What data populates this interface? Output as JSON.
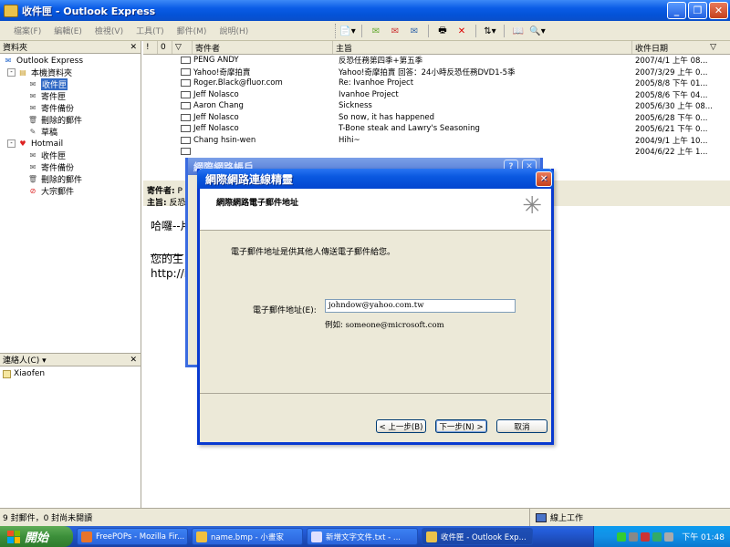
{
  "window": {
    "title": "收件匣 - Outlook Express"
  },
  "menu": [
    "檔案(F)",
    "編輯(E)",
    "檢視(V)",
    "工具(T)",
    "郵件(M)",
    "說明(H)"
  ],
  "folders": {
    "header": "資料夾",
    "items": [
      {
        "label": "Outlook Express",
        "level": 0,
        "icon": "outlook-icon"
      },
      {
        "label": "本機資料夾",
        "level": 1,
        "icon": "local-folders-icon",
        "expand": "-"
      },
      {
        "label": "收件匣",
        "level": 2,
        "icon": "inbox-icon",
        "selected": true
      },
      {
        "label": "寄件匣",
        "level": 2,
        "icon": "outbox-icon"
      },
      {
        "label": "寄件備份",
        "level": 2,
        "icon": "sent-items-icon"
      },
      {
        "label": "刪除的郵件",
        "level": 2,
        "icon": "deleted-items-icon"
      },
      {
        "label": "草稿",
        "level": 2,
        "icon": "drafts-icon"
      },
      {
        "label": "Hotmail",
        "level": 1,
        "icon": "hotmail-icon",
        "expand": "-"
      },
      {
        "label": "收件匣",
        "level": 2,
        "icon": "inbox-icon"
      },
      {
        "label": "寄件備份",
        "level": 2,
        "icon": "sent-items-icon"
      },
      {
        "label": "刪除的郵件",
        "level": 2,
        "icon": "deleted-items-icon"
      },
      {
        "label": "大宗郵件",
        "level": 2,
        "icon": "junk-mail-icon"
      }
    ]
  },
  "contacts": {
    "header": "連絡人(C) ▾",
    "items": [
      "Xiaofen"
    ]
  },
  "message_list": {
    "columns": [
      "!",
      "0",
      "▽",
      "寄件者",
      "主旨",
      "收件日期"
    ],
    "rows": [
      {
        "from": "PENG ANDY",
        "subject": "反恐任務第四季+第五季",
        "date": "2007/4/1 上午 08..."
      },
      {
        "from": "Yahoo!奇摩拍賣",
        "subject": "Yahoo!奇摩拍賣 回答：24小時反恐任務DVD1-5季",
        "date": "2007/3/29 上午 0..."
      },
      {
        "from": "Roger.Black@fluor.com",
        "subject": "Re: Ivanhoe Project",
        "date": "2005/8/8 下午 01..."
      },
      {
        "from": "Jeff Nolasco",
        "subject": "Ivanhoe Project",
        "date": "2005/8/6 下午 04..."
      },
      {
        "from": "Aaron Chang",
        "subject": "Sickness",
        "date": "2005/6/30 上午 08..."
      },
      {
        "from": "Jeff Nolasco",
        "subject": "So now, it has happened",
        "date": "2005/6/28 下午 0..."
      },
      {
        "from": "Jeff Nolasco",
        "subject": "T-Bone steak and Lawry's Seasoning",
        "date": "2005/6/21 下午 0..."
      },
      {
        "from": "Chang hsin-wen",
        "subject": "Hihi~",
        "date": "2004/9/1 上午 10..."
      },
      {
        "from": "",
        "subject": "",
        "date": "2004/6/22 上午 1..."
      }
    ]
  },
  "preview": {
    "from_label": "寄件者:",
    "from_value": "P",
    "subject_label": "主旨:",
    "subject_value": "反恐",
    "body_lines": [
      "哈囉--片",
      "______",
      "您的生",
      "http://m"
    ]
  },
  "back_dialog": {
    "title": "網際網路帳戶"
  },
  "wizard": {
    "title": "網際網路連線精靈",
    "heading": "網際網路電子郵件地址",
    "intro": "電子郵件地址是供其他人傳送電子郵件給您。",
    "email_label": "電子郵件地址(E):",
    "email_value": "johndow@yahoo.com.tw",
    "example_label": "例如:",
    "example_value": "someone@microsoft.com",
    "back_button": "< 上一步(B)",
    "next_button": "下一步(N) >",
    "cancel_button": "取消"
  },
  "status": {
    "left": "9 封郵件，0 封尚未閱讀",
    "right": "線上工作"
  },
  "taskbar": {
    "start": "開始",
    "tasks": [
      {
        "label": "FreePOPs - Mozilla Fir...",
        "color": "#e8742c"
      },
      {
        "label": "name.bmp - 小畫家",
        "color": "#f0c040"
      },
      {
        "label": "新增文字文件.txt - ...",
        "color": "#e0e0ff"
      },
      {
        "label": "收件匣 - Outlook Exp...",
        "color": "#eac24b",
        "active": true
      }
    ],
    "clock": "下午 01:48"
  },
  "colors": {
    "title_blue": "#0a5ce6",
    "selection": "#316ac5",
    "xp_face": "#ece9d8"
  }
}
